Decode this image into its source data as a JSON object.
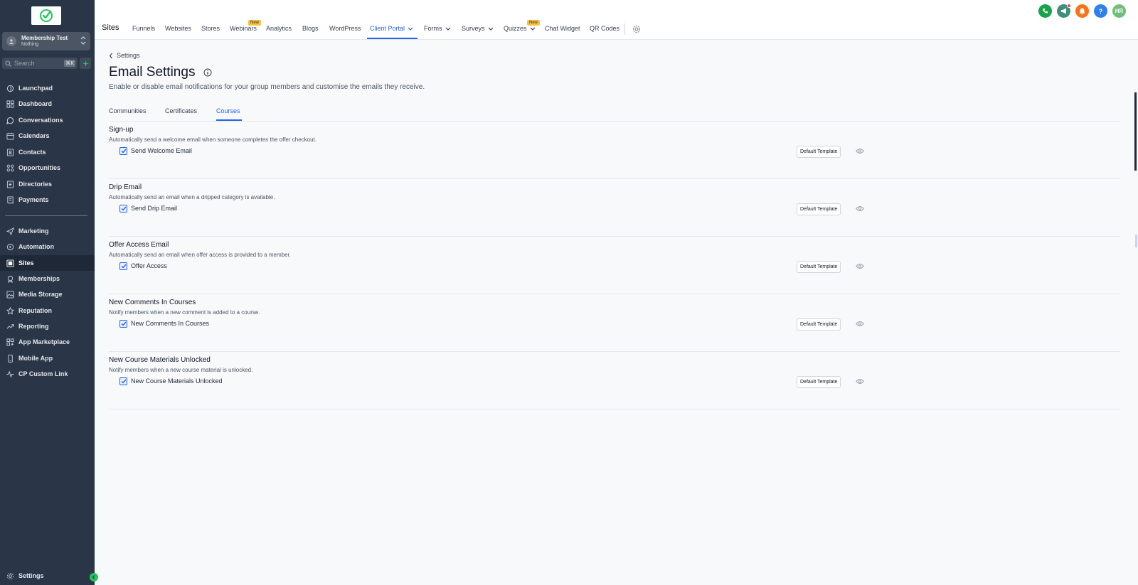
{
  "sidebar": {
    "account": {
      "name": "Membership Test",
      "sub": "Nothing"
    },
    "search": {
      "placeholder": "Search",
      "shortcut": "⌘K"
    },
    "items": [
      {
        "label": "Launchpad",
        "icon": "rocket-icon"
      },
      {
        "label": "Dashboard",
        "icon": "grid-icon"
      },
      {
        "label": "Conversations",
        "icon": "chat-icon"
      },
      {
        "label": "Calendars",
        "icon": "calendar-icon"
      },
      {
        "label": "Contacts",
        "icon": "contact-card-icon"
      },
      {
        "label": "Opportunities",
        "icon": "opportunities-icon"
      },
      {
        "label": "Directories",
        "icon": "directory-icon"
      },
      {
        "label": "Payments",
        "icon": "receipt-icon"
      },
      {
        "label": "Marketing",
        "icon": "send-icon"
      },
      {
        "label": "Automation",
        "icon": "automation-icon"
      },
      {
        "label": "Sites",
        "icon": "sites-icon"
      },
      {
        "label": "Memberships",
        "icon": "membership-icon"
      },
      {
        "label": "Media Storage",
        "icon": "image-icon"
      },
      {
        "label": "Reputation",
        "icon": "star-icon"
      },
      {
        "label": "Reporting",
        "icon": "trend-icon"
      },
      {
        "label": "App Marketplace",
        "icon": "apps-icon"
      },
      {
        "label": "Mobile App",
        "icon": "mobile-icon"
      },
      {
        "label": "CP Custom Link",
        "icon": "pulse-icon"
      }
    ],
    "active": "Sites",
    "settings_label": "Settings"
  },
  "topbar": {
    "title": "Sites",
    "nav": [
      "Funnels",
      "Websites",
      "Stores",
      "Webinars",
      "Analytics",
      "Blogs",
      "WordPress",
      "Client Portal",
      "Forms",
      "Surveys",
      "Quizzes",
      "Chat Widget",
      "QR Codes"
    ],
    "active": "Client Portal",
    "new_badge": "New",
    "avatar_initials": "HR",
    "help_glyph": "?",
    "colors": {
      "phone": "#16a34a",
      "megaphone": "#3f8f7b",
      "bell": "#f97316",
      "help": "#2f80ed",
      "avatar": "#6fbf7a"
    }
  },
  "main": {
    "back_label": "Settings",
    "title": "Email Settings",
    "subtitle": "Enable or disable email notifications for your group members and customise the emails they receive.",
    "tabs": [
      "Communities",
      "Certificates",
      "Courses"
    ],
    "active_tab": "Courses",
    "template_label": "Default Template",
    "sections": [
      {
        "title": "Sign-up",
        "desc": "Automatically send a welcome email when someone completes the offer checkout.",
        "checkbox": "Send Welcome Email",
        "checked": true
      },
      {
        "title": "Drip Email",
        "desc": "Automatically send an email when a dripped category is available.",
        "checkbox": "Send Drip Email",
        "checked": true
      },
      {
        "title": "Offer Access Email",
        "desc": "Automatically send an email when offer access is provided to a member.",
        "checkbox": "Offer Access",
        "checked": true
      },
      {
        "title": "New Comments In Courses",
        "desc": "Notify members when a new comment is added to a course.",
        "checkbox": "New Comments In Courses",
        "checked": true
      },
      {
        "title": "New Course Materials Unlocked",
        "desc": "Notify members when a new course material is unlocked.",
        "checkbox": "New Course Materials Unlocked",
        "checked": true
      }
    ]
  },
  "colors": {
    "sidebar_bg": "#2a3647",
    "accent": "#2563eb",
    "page_bg": "#f8f9fb"
  }
}
